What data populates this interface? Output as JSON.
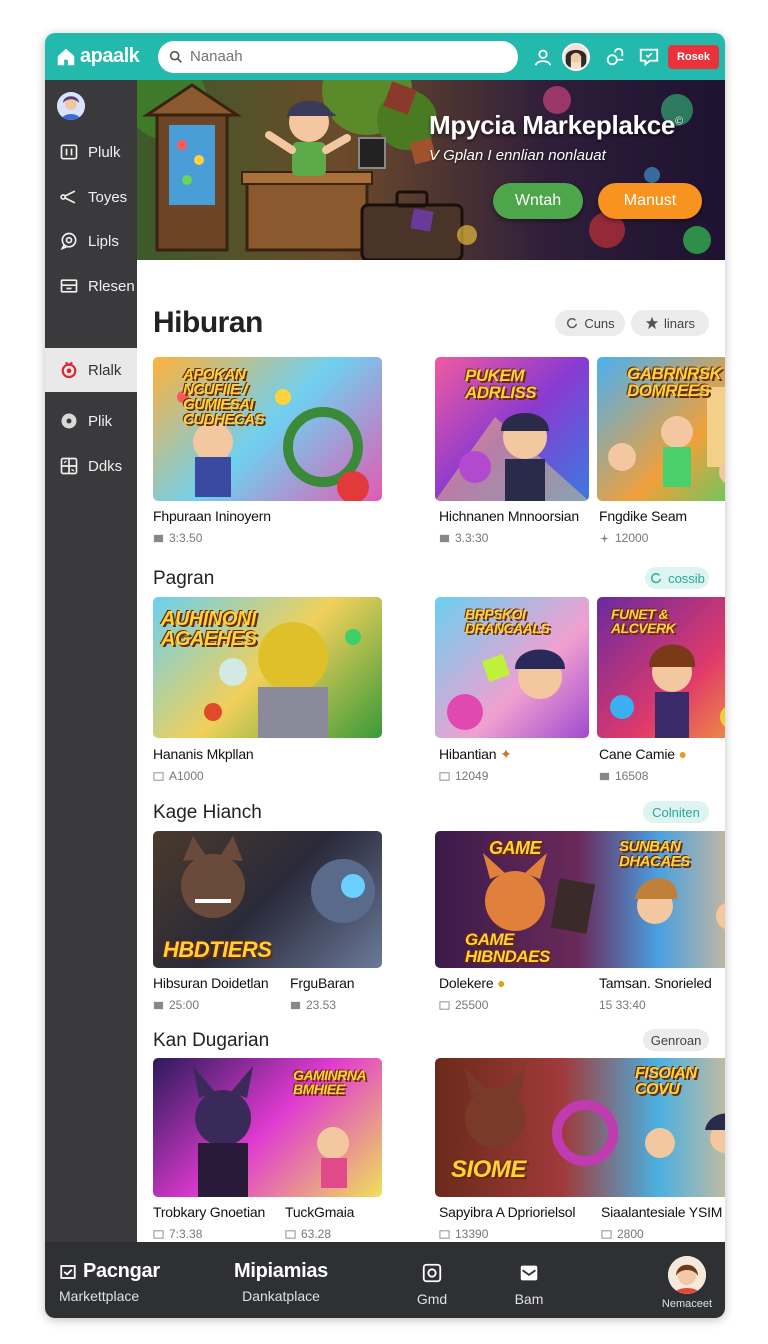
{
  "app": {
    "logo_text": "apaalk",
    "search_placeholder": "Nanaah",
    "top_button": "Rosek"
  },
  "sidebar": {
    "items": [
      {
        "label": "Plulk",
        "icon": "grid-icon"
      },
      {
        "label": "Toyes",
        "icon": "share-icon"
      },
      {
        "label": "Lipls",
        "icon": "chat-icon"
      },
      {
        "label": "Rlesen",
        "icon": "inbox-icon"
      },
      {
        "label": "Rlalk",
        "icon": "target-icon",
        "active": true
      },
      {
        "label": "Plik",
        "icon": "disc-icon"
      },
      {
        "label": "Ddks",
        "icon": "apps-icon"
      }
    ]
  },
  "hero": {
    "title": "Mpycia Markeplakce",
    "title_mark": "©",
    "subtitle": "V Gplan I ennlian nonlauat",
    "btn_primary": "Wntah",
    "btn_secondary": "Manust"
  },
  "sections": [
    {
      "title": "Hiburan",
      "pills": [
        {
          "label": "Cuns"
        },
        {
          "label": "linars"
        }
      ],
      "cards": [
        {
          "title": "Fhpuraan Ininoyern",
          "meta": "3:3.50",
          "art": "APOKAN NCUFIIE / GUMIESAI CUDHECAS"
        },
        {
          "title": "Hichnanen Mnnoorsian",
          "meta": "3.3:30",
          "art": "PUKEM ADRLISS"
        },
        {
          "title": "Fngdike Seam",
          "meta": "12000",
          "art": "GABRNRSK DOMREES"
        }
      ]
    },
    {
      "title": "Pagran",
      "pills": [
        {
          "label": "cossib"
        }
      ],
      "cards": [
        {
          "title": "Hananis Mkpllan",
          "meta": "A1000",
          "art": "AUHINONI AGAEHES"
        },
        {
          "title": "Hibantian",
          "meta": "12049",
          "art": "BRPSKOI DRANCAALS"
        },
        {
          "title": "Cane Camie",
          "meta": "16508",
          "art": "FUNET & ALCVERK"
        }
      ]
    },
    {
      "title": "Kage Hianch",
      "pills": [
        {
          "label": "Colniten"
        }
      ],
      "cards": [
        {
          "title": "Hibsuran Doidetlan",
          "meta": "25:00",
          "art": "HBDTIERS"
        },
        {
          "title": "FrguBaran",
          "meta": "23.53",
          "art": ""
        },
        {
          "title": "Dolekere",
          "meta": "25500",
          "art": "GAME HIBNDAES"
        },
        {
          "title": "Tamsan. Snorieled",
          "meta": "15 33:40",
          "art": "SUNBAN DHACAES"
        }
      ]
    },
    {
      "title": "Kan Dugarian",
      "pills": [
        {
          "label": "Genroan"
        }
      ],
      "cards": [
        {
          "title": "Trobkary Gnoetian",
          "meta": "7:3.38",
          "art": "GAMINRNA BMHIEE"
        },
        {
          "title": "TuckGmaia",
          "meta": "63.28",
          "art": ""
        },
        {
          "title": "Sapyibra A Dpriorielsol",
          "meta": "13390",
          "art": "SIOME"
        },
        {
          "title": "Siaalantesiale YSIM",
          "meta": "2800",
          "art": "FISOIAN COVU"
        }
      ]
    }
  ],
  "bottombar": {
    "items": [
      {
        "big": "Pacngar",
        "small": "Markettplace"
      },
      {
        "big": "Mipiamias",
        "small": "Dankatplace"
      },
      {
        "small": "Gmd"
      },
      {
        "small": "Bam"
      },
      {
        "small": "Nemaceet"
      }
    ]
  },
  "colors": {
    "topbar": "#23b9ad",
    "sidebar": "#3a3a3d",
    "accent_green": "#4ea64a",
    "accent_orange": "#f7931e",
    "danger": "#e8333a"
  }
}
